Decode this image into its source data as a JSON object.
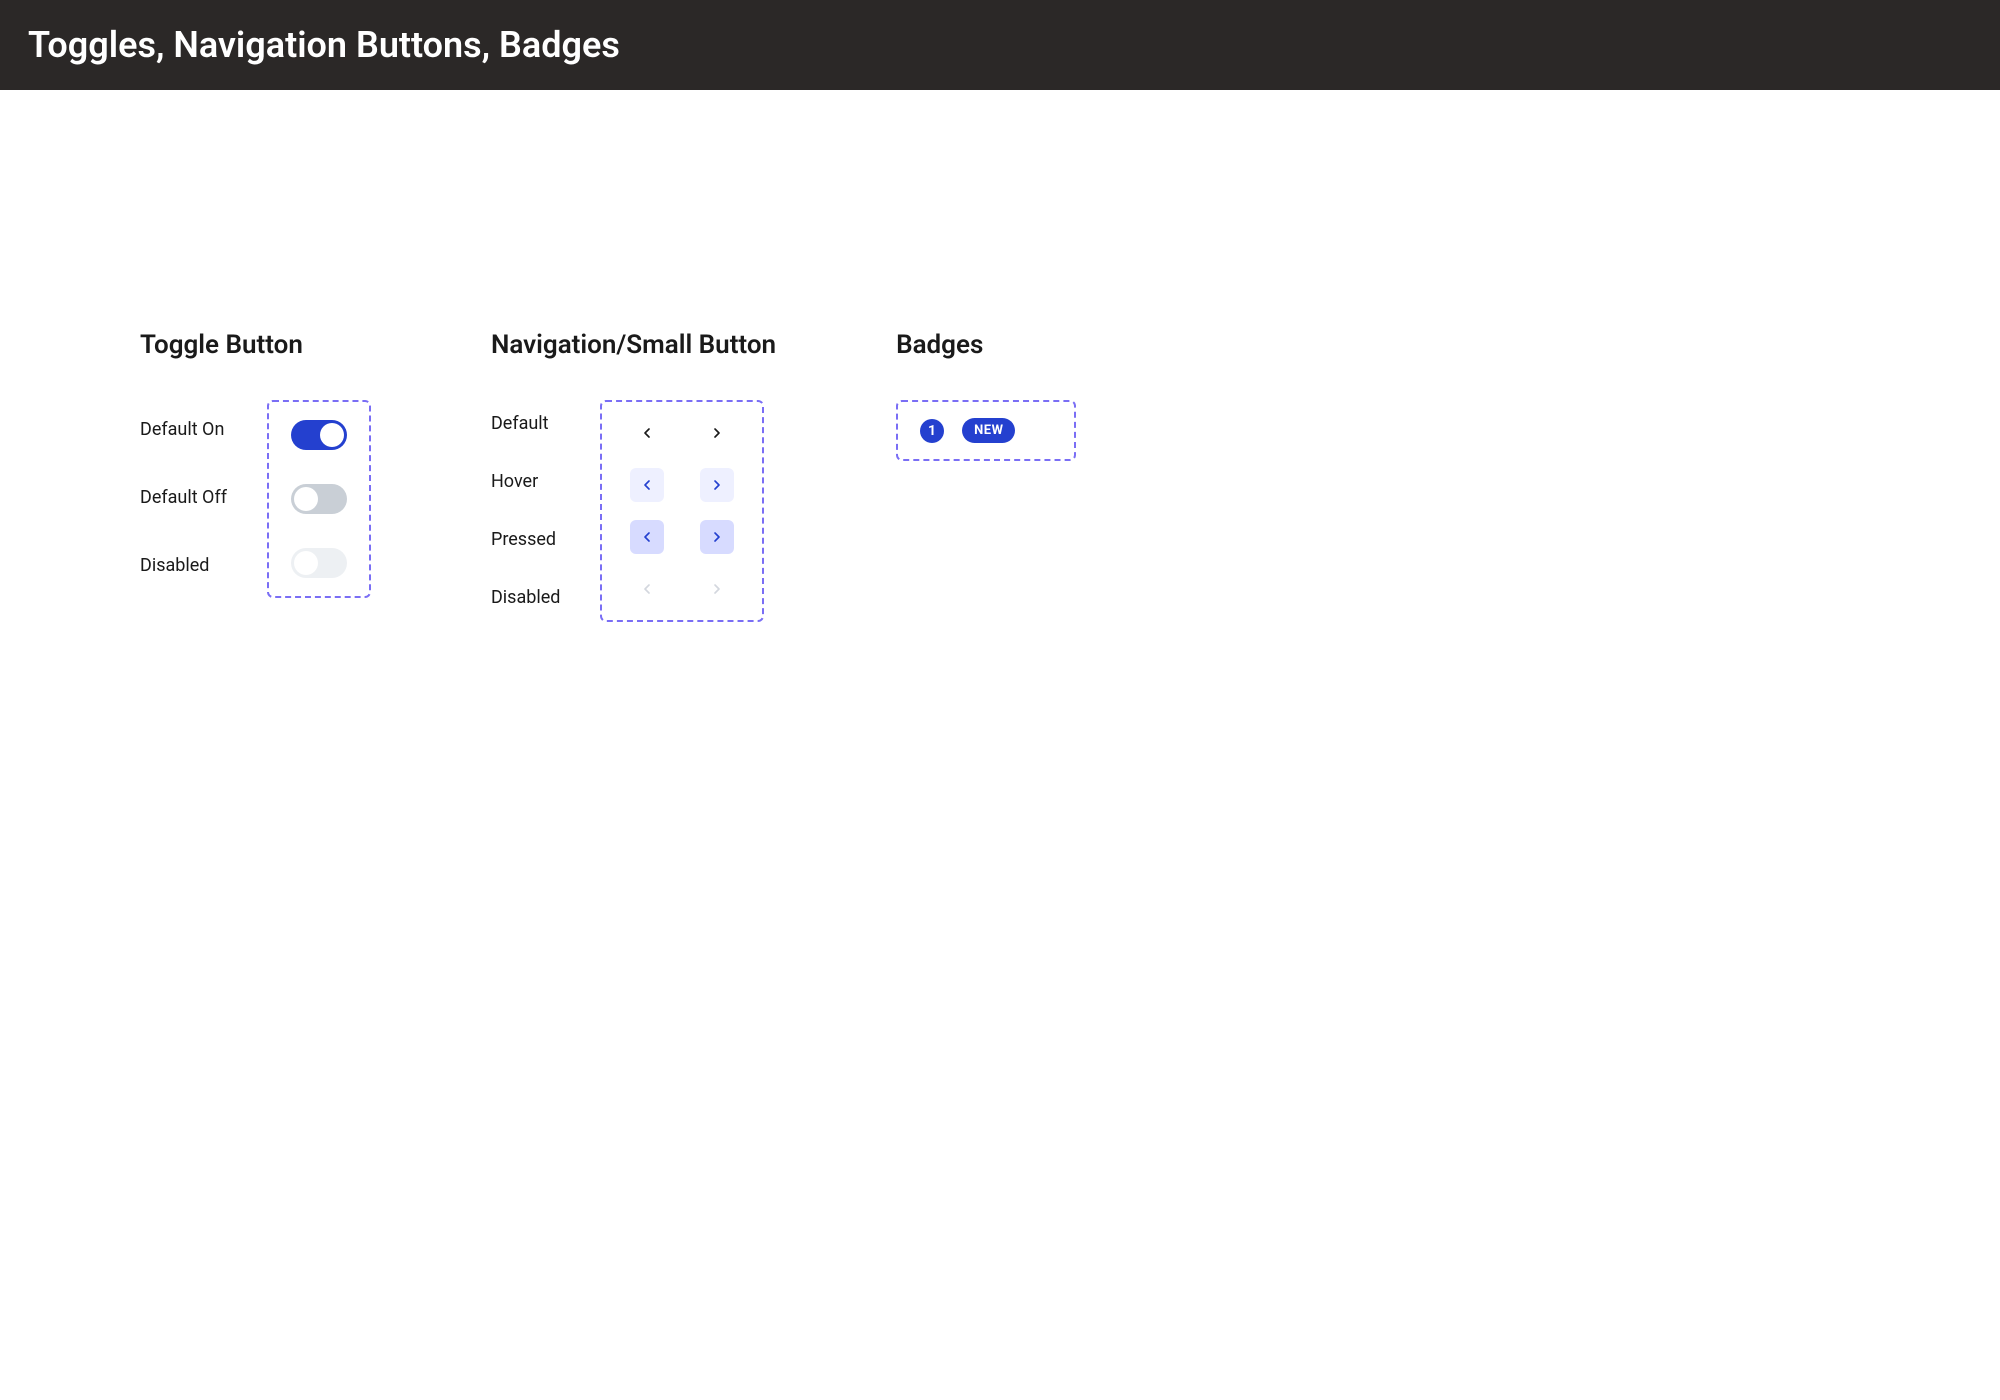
{
  "header": {
    "title": "Toggles, Navigation Buttons, Badges"
  },
  "toggles": {
    "title": "Toggle Button",
    "states": {
      "on_label": "Default On",
      "off_label": "Default Off",
      "disabled_label": "Disabled"
    }
  },
  "nav": {
    "title": "Navigation/Small Button",
    "states": {
      "default_label": "Default",
      "hover_label": "Hover",
      "pressed_label": "Pressed",
      "disabled_label": "Disabled"
    }
  },
  "badges": {
    "title": "Badges",
    "count": "1",
    "text": "NEW"
  },
  "colors": {
    "primary": "#2440cf",
    "dashed": "#7a6ef5",
    "header_bg": "#2b2827"
  }
}
